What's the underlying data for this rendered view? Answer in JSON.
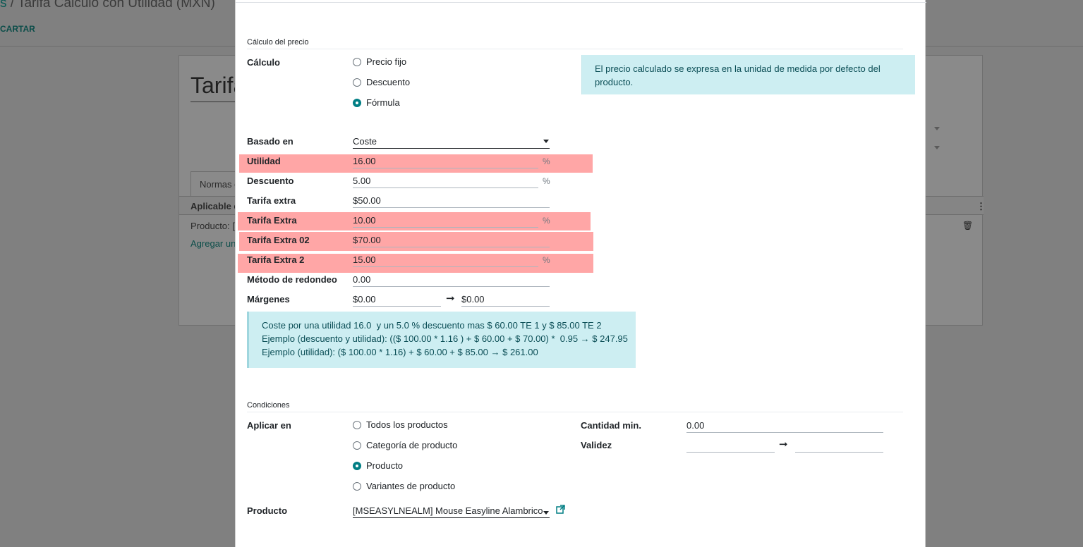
{
  "background": {
    "breadcrumb_prefix": "s",
    "title": " / Tarifa Calculo con Utilidad (MXN)",
    "discard": "CARTAR",
    "record_name": "Tarifa",
    "tab": "Normas de precio",
    "table_header": "Aplicable en",
    "row_text": "Producto: [",
    "add_line": "Agregar una línea",
    "kebab": "⋮",
    "trash": "🗑"
  },
  "modal": {
    "price_section": {
      "title": "Cálculo del precio",
      "calc_label": "Cálculo",
      "options": [
        {
          "label": "Precio fijo",
          "selected": false
        },
        {
          "label": "Descuento",
          "selected": false
        },
        {
          "label": "Fórmula",
          "selected": true
        }
      ],
      "info": "El precio calculado se expresa en la unidad de medida por defecto del producto.",
      "based_on_label": "Basado en",
      "based_on_value": "Coste",
      "utilidad_label": "Utilidad",
      "utilidad_value": "16.00",
      "descuento_label": "Descuento",
      "descuento_value": "5.00",
      "tarifa_extra_label": "Tarifa extra",
      "tarifa_extra_value": "$50.00",
      "tarifa_extra_pct_label": "Tarifa Extra",
      "tarifa_extra_pct_value": "10.00",
      "tarifa_extra02_label": "Tarifa Extra 02",
      "tarifa_extra02_value": "$70.00",
      "tarifa_extra2_label": "Tarifa Extra 2",
      "tarifa_extra2_value": "15.00",
      "rounding_label": "Método de redondeo",
      "rounding_value": "0.00",
      "margins_label": "Márgenes",
      "margin_min": "$0.00",
      "margin_max": "$0.00",
      "percent": "%",
      "arrow": "➞",
      "example_lines": [
        "Coste por una utilidad 16.0  y un 5.0 % descuento mas $ 60.00 TE 1 y $ 85.00 TE 2",
        "Ejemplo (descuento y utilidad): (($ 100.00 * 1.16 ) + $ 60.00 + $ 70.00) *  0.95 → $ 247.95",
        "Ejemplo (utilidad): ($ 100.00 * 1.16) + $ 60.00 + $ 85.00 → $ 261.00"
      ]
    },
    "conditions": {
      "title": "Condiciones",
      "apply_label": "Aplicar en",
      "options": [
        {
          "label": "Todos los productos",
          "selected": false
        },
        {
          "label": "Categoría de producto",
          "selected": false
        },
        {
          "label": "Producto",
          "selected": true
        },
        {
          "label": "Variantes de producto",
          "selected": false
        }
      ],
      "min_qty_label": "Cantidad min.",
      "min_qty_value": "0.00",
      "validity_label": "Validez",
      "validity_from": "",
      "validity_to": "",
      "product_label": "Producto",
      "product_value": "[MSEASYLNEALM] Mouse Easyline Alambrico",
      "ext_link_icon": "↗"
    }
  },
  "colors": {
    "highlight": "#ffa6a6",
    "info_bg": "#cdeef2",
    "accent": "#017e84"
  }
}
